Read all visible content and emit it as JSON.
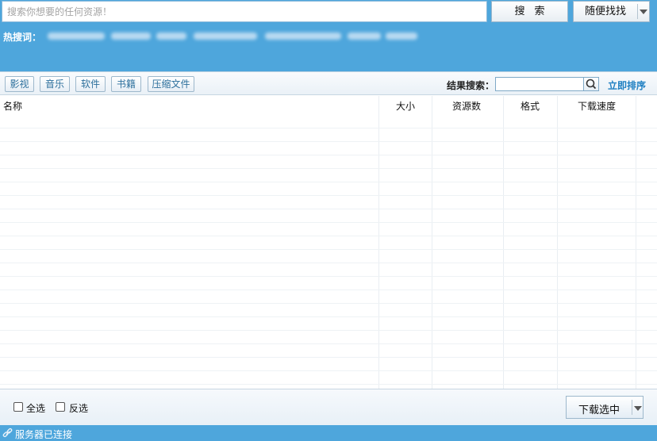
{
  "search": {
    "placeholder": "搜索你想要的任何资源！",
    "search_button": "搜索",
    "random_button": "随便找找",
    "hot_label": "热搜词："
  },
  "categories": [
    "影视",
    "音乐",
    "软件",
    "书籍",
    "压缩文件"
  ],
  "result_search": {
    "label": "结果搜索：",
    "sort_link": "立即排序"
  },
  "table": {
    "columns": [
      "名称",
      "大小",
      "资源数",
      "格式",
      "下载速度"
    ]
  },
  "bottom": {
    "select_all": "全选",
    "invert": "反选",
    "download_button": "下载选中"
  },
  "status": {
    "text": "服务器已连接"
  },
  "colors": {
    "accent_blue": "#4ea6dc",
    "link_blue": "#1e7fc2"
  },
  "icons": {
    "search_button_icon": "search-icon",
    "status_icon": "link-icon",
    "dropdown": "chevron-down-icon"
  }
}
